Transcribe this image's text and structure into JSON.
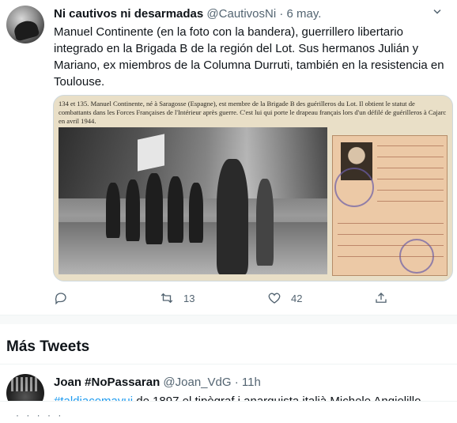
{
  "tweet": {
    "display_name": "Ni cautivos ni desarmadas",
    "handle": "@CautivosNi",
    "separator": "·",
    "date": "6 may.",
    "text": "Manuel Continente (en la foto con la bandera), guerrillero libertario integrado en la Brigada B de la región del Lot. Sus hermanos Julián y Mariano, ex miembros de la Columna Durruti, también en la resistencia en Toulouse.",
    "media": {
      "caption": "134 et 135. Manuel Continente, né à Saragosse (Espagne), est membre de la Brigade B des guérilleros du Lot. Il obtient le statut de combattants dans les Forces Françaises de l'Intérieur après guerre. C'est lui qui porte le drapeau français lors d'un défilé de guérilleros à Cajarc en avril 1944."
    },
    "actions": {
      "reply_icon": "reply-icon",
      "retweet_icon": "retweet-icon",
      "retweet_count": "13",
      "like_icon": "heart-icon",
      "like_count": "42",
      "share_icon": "share-icon"
    }
  },
  "more_tweets": {
    "heading": "Más Tweets"
  },
  "tweet2": {
    "display_name": "Joan #NoPassaran",
    "handle": "@Joan_VdG",
    "separator": "·",
    "date": "11h",
    "hashtag": "#taldiacomavui",
    "text": " de 1897 el tipògraf i anarquista italià Michele Angiolillo"
  },
  "colors": {
    "link": "#1d9bf0",
    "secondary_text": "#536471",
    "primary_text": "#0f1419"
  }
}
